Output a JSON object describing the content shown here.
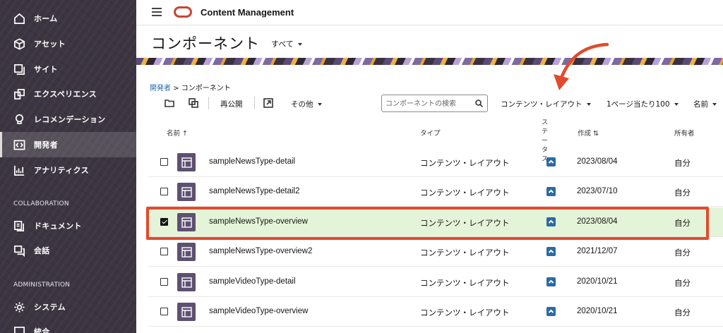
{
  "sidebar": {
    "items": [
      {
        "label": "ホーム",
        "icon": "home-icon"
      },
      {
        "label": "アセット",
        "icon": "cube-icon"
      },
      {
        "label": "サイト",
        "icon": "sites-icon"
      },
      {
        "label": "エクスペリエンス",
        "icon": "experience-icon"
      },
      {
        "label": "レコメンデーション",
        "icon": "lightbulb-icon"
      },
      {
        "label": "開発者",
        "icon": "code-icon",
        "active": true
      },
      {
        "label": "アナリティクス",
        "icon": "analytics-icon"
      }
    ],
    "section_collaboration": "COLLABORATION",
    "collab_items": [
      {
        "label": "ドキュメント",
        "icon": "documents-icon"
      },
      {
        "label": "会話",
        "icon": "conversation-icon"
      }
    ],
    "section_administration": "ADMINISTRATION",
    "admin_items": [
      {
        "label": "システム",
        "icon": "gear-icon"
      },
      {
        "label": "統合",
        "icon": "integration-icon"
      }
    ]
  },
  "topbar": {
    "app_title": "Content Management"
  },
  "header": {
    "page_title": "コンポーネント",
    "filter_label": "すべて"
  },
  "breadcrumb": {
    "parent": "開発者",
    "separator": " > ",
    "current": "コンポーネント"
  },
  "toolbar": {
    "republish_label": "再公開",
    "more_label": "その他",
    "search_placeholder": "コンポーネントの検索",
    "type_filter_label": "コンテンツ・レイアウト",
    "per_page_label": "1ページ当たり100",
    "sort_label": "名前"
  },
  "table": {
    "headers": {
      "name": "名前 ↑",
      "type": "タイプ",
      "status": "ステータス",
      "created": "作成 ⇅",
      "owner": "所有者"
    },
    "rows": [
      {
        "name": "sampleNewsType-detail",
        "type": "コンテンツ・レイアウト",
        "date": "2023/08/04",
        "owner": "自分",
        "selected": false
      },
      {
        "name": "sampleNewsType-detail2",
        "type": "コンテンツ・レイアウト",
        "date": "2023/07/10",
        "owner": "自分",
        "selected": false
      },
      {
        "name": "sampleNewsType-overview",
        "type": "コンテンツ・レイアウト",
        "date": "2023/08/04",
        "owner": "自分",
        "selected": true
      },
      {
        "name": "sampleNewsType-overview2",
        "type": "コンテンツ・レイアウト",
        "date": "2021/12/07",
        "owner": "自分",
        "selected": false
      },
      {
        "name": "sampleVideoType-detail",
        "type": "コンテンツ・レイアウト",
        "date": "2020/10/21",
        "owner": "自分",
        "selected": false
      },
      {
        "name": "sampleVideoType-overview",
        "type": "コンテンツ・レイアウト",
        "date": "2020/10/21",
        "owner": "自分",
        "selected": false
      }
    ]
  },
  "colors": {
    "sidebar_bg": "#3c3541",
    "brand_red": "#c74634",
    "link_blue": "#2a6aa6",
    "selected_row": "#e4f4d8",
    "annotation": "#e24a2d"
  }
}
